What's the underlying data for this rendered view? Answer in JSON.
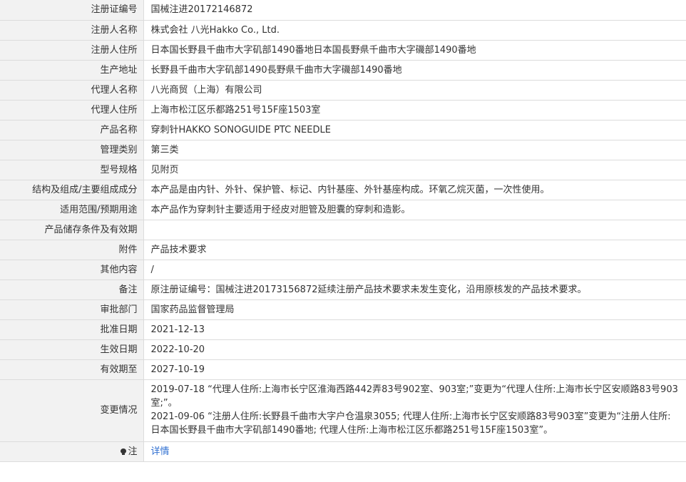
{
  "rows": [
    {
      "label": "注册证编号",
      "value": "国械注进20172146872"
    },
    {
      "label": "注册人名称",
      "value": "株式会社 八光Hakko Co., Ltd."
    },
    {
      "label": "注册人住所",
      "value": "日本国长野县千曲市大字矶部1490番地日本国長野県千曲市大字磯部1490番地"
    },
    {
      "label": "生产地址",
      "value": "长野县千曲市大字矶部1490長野県千曲市大字磯部1490番地"
    },
    {
      "label": "代理人名称",
      "value": "八光商贸（上海）有限公司"
    },
    {
      "label": "代理人住所",
      "value": "上海市松江区乐都路251号15F座1503室"
    },
    {
      "label": "产品名称",
      "value": "穿刺针HAKKO SONOGUIDE PTC NEEDLE"
    },
    {
      "label": "管理类别",
      "value": "第三类"
    },
    {
      "label": "型号规格",
      "value": "见附页"
    },
    {
      "label": "结构及组成/主要组成成分",
      "value": "本产品是由内针、外针、保护管、标记、内针基座、外针基座构成。环氧乙烷灭菌，一次性使用。"
    },
    {
      "label": "适用范围/预期用途",
      "value": "本产品作为穿刺针主要适用于经皮对胆管及胆囊的穿刺和造影。"
    },
    {
      "label": "产品储存条件及有效期",
      "value": ""
    },
    {
      "label": "附件",
      "value": "产品技术要求"
    },
    {
      "label": "其他内容",
      "value": "/"
    },
    {
      "label": "备注",
      "value": "原注册证编号：国械注进20173156872延续注册产品技术要求未发生变化，沿用原核发的产品技术要求。"
    },
    {
      "label": "审批部门",
      "value": "国家药品监督管理局"
    },
    {
      "label": "批准日期",
      "value": "2021-12-13"
    },
    {
      "label": "生效日期",
      "value": "2022-10-20"
    },
    {
      "label": "有效期至",
      "value": "2027-10-19"
    }
  ],
  "changes": {
    "label": "变更情况",
    "entries": [
      "2019-07-18 “代理人住所:上海市长宁区淮海西路442弄83号902室、903室;”变更为“代理人住所:上海市长宁区安顺路83号903室;”。",
      "2021-09-06 “注册人住所:长野县千曲市大字户仓温泉3055; 代理人住所:上海市长宁区安顺路83号903室”变更为“注册人住所:日本国长野县千曲市大字矶部1490番地; 代理人住所:上海市松江区乐都路251号15F座1503室”。"
    ]
  },
  "note": {
    "label": "注",
    "icon": "lightbulb-icon",
    "link_text": "详情",
    "link_color": "#2f6fd1"
  }
}
